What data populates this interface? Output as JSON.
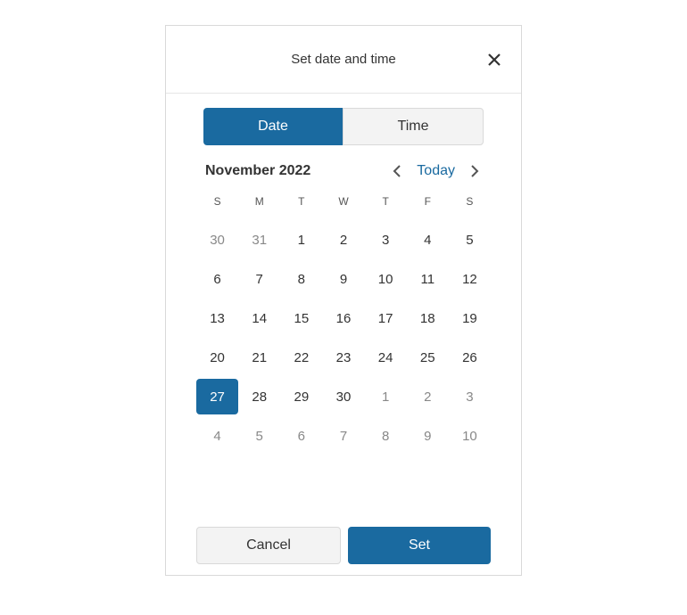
{
  "header": {
    "title": "Set date and time"
  },
  "tabs": {
    "date": "Date",
    "time": "Time"
  },
  "calendar": {
    "month_label": "November 2022",
    "today_label": "Today",
    "day_headers": [
      "S",
      "M",
      "T",
      "W",
      "T",
      "F",
      "S"
    ],
    "weeks": [
      [
        {
          "day": "30",
          "kind": "other-month"
        },
        {
          "day": "31",
          "kind": "other-month"
        },
        {
          "day": "1",
          "kind": "current-month"
        },
        {
          "day": "2",
          "kind": "current-month"
        },
        {
          "day": "3",
          "kind": "current-month"
        },
        {
          "day": "4",
          "kind": "current-month"
        },
        {
          "day": "5",
          "kind": "current-month"
        }
      ],
      [
        {
          "day": "6",
          "kind": "current-month"
        },
        {
          "day": "7",
          "kind": "current-month"
        },
        {
          "day": "8",
          "kind": "current-month"
        },
        {
          "day": "9",
          "kind": "current-month"
        },
        {
          "day": "10",
          "kind": "current-month"
        },
        {
          "day": "11",
          "kind": "current-month"
        },
        {
          "day": "12",
          "kind": "current-month"
        }
      ],
      [
        {
          "day": "13",
          "kind": "current-month"
        },
        {
          "day": "14",
          "kind": "current-month"
        },
        {
          "day": "15",
          "kind": "current-month"
        },
        {
          "day": "16",
          "kind": "current-month"
        },
        {
          "day": "17",
          "kind": "current-month"
        },
        {
          "day": "18",
          "kind": "current-month"
        },
        {
          "day": "19",
          "kind": "current-month"
        }
      ],
      [
        {
          "day": "20",
          "kind": "current-month"
        },
        {
          "day": "21",
          "kind": "current-month"
        },
        {
          "day": "22",
          "kind": "current-month"
        },
        {
          "day": "23",
          "kind": "current-month"
        },
        {
          "day": "24",
          "kind": "current-month"
        },
        {
          "day": "25",
          "kind": "current-month"
        },
        {
          "day": "26",
          "kind": "current-month"
        }
      ],
      [
        {
          "day": "27",
          "kind": "current-month",
          "selected": true
        },
        {
          "day": "28",
          "kind": "current-month"
        },
        {
          "day": "29",
          "kind": "current-month"
        },
        {
          "day": "30",
          "kind": "current-month"
        },
        {
          "day": "1",
          "kind": "other-month"
        },
        {
          "day": "2",
          "kind": "other-month"
        },
        {
          "day": "3",
          "kind": "other-month"
        }
      ],
      [
        {
          "day": "4",
          "kind": "other-month"
        },
        {
          "day": "5",
          "kind": "other-month"
        },
        {
          "day": "6",
          "kind": "other-month"
        },
        {
          "day": "7",
          "kind": "other-month"
        },
        {
          "day": "8",
          "kind": "other-month"
        },
        {
          "day": "9",
          "kind": "other-month"
        },
        {
          "day": "10",
          "kind": "other-month"
        }
      ]
    ]
  },
  "footer": {
    "cancel": "Cancel",
    "set": "Set"
  },
  "colors": {
    "accent": "#1a6aa0"
  }
}
